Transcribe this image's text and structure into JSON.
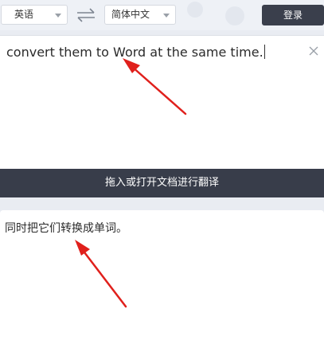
{
  "toolbar": {
    "source_language": "英语",
    "target_language": "简体中文",
    "login_label": "登录"
  },
  "source": {
    "text": "convert them to Word at the same time."
  },
  "action": {
    "label": "拖入或打开文档进行翻译"
  },
  "result": {
    "text": "同时把它们转换成单词。"
  },
  "colors": {
    "dark": "#383d4a",
    "annotation_arrow": "#e0201c"
  },
  "icons": {
    "swap": "swap-arrows-icon",
    "clear": "close-icon",
    "caret": "chevron-down-icon"
  }
}
